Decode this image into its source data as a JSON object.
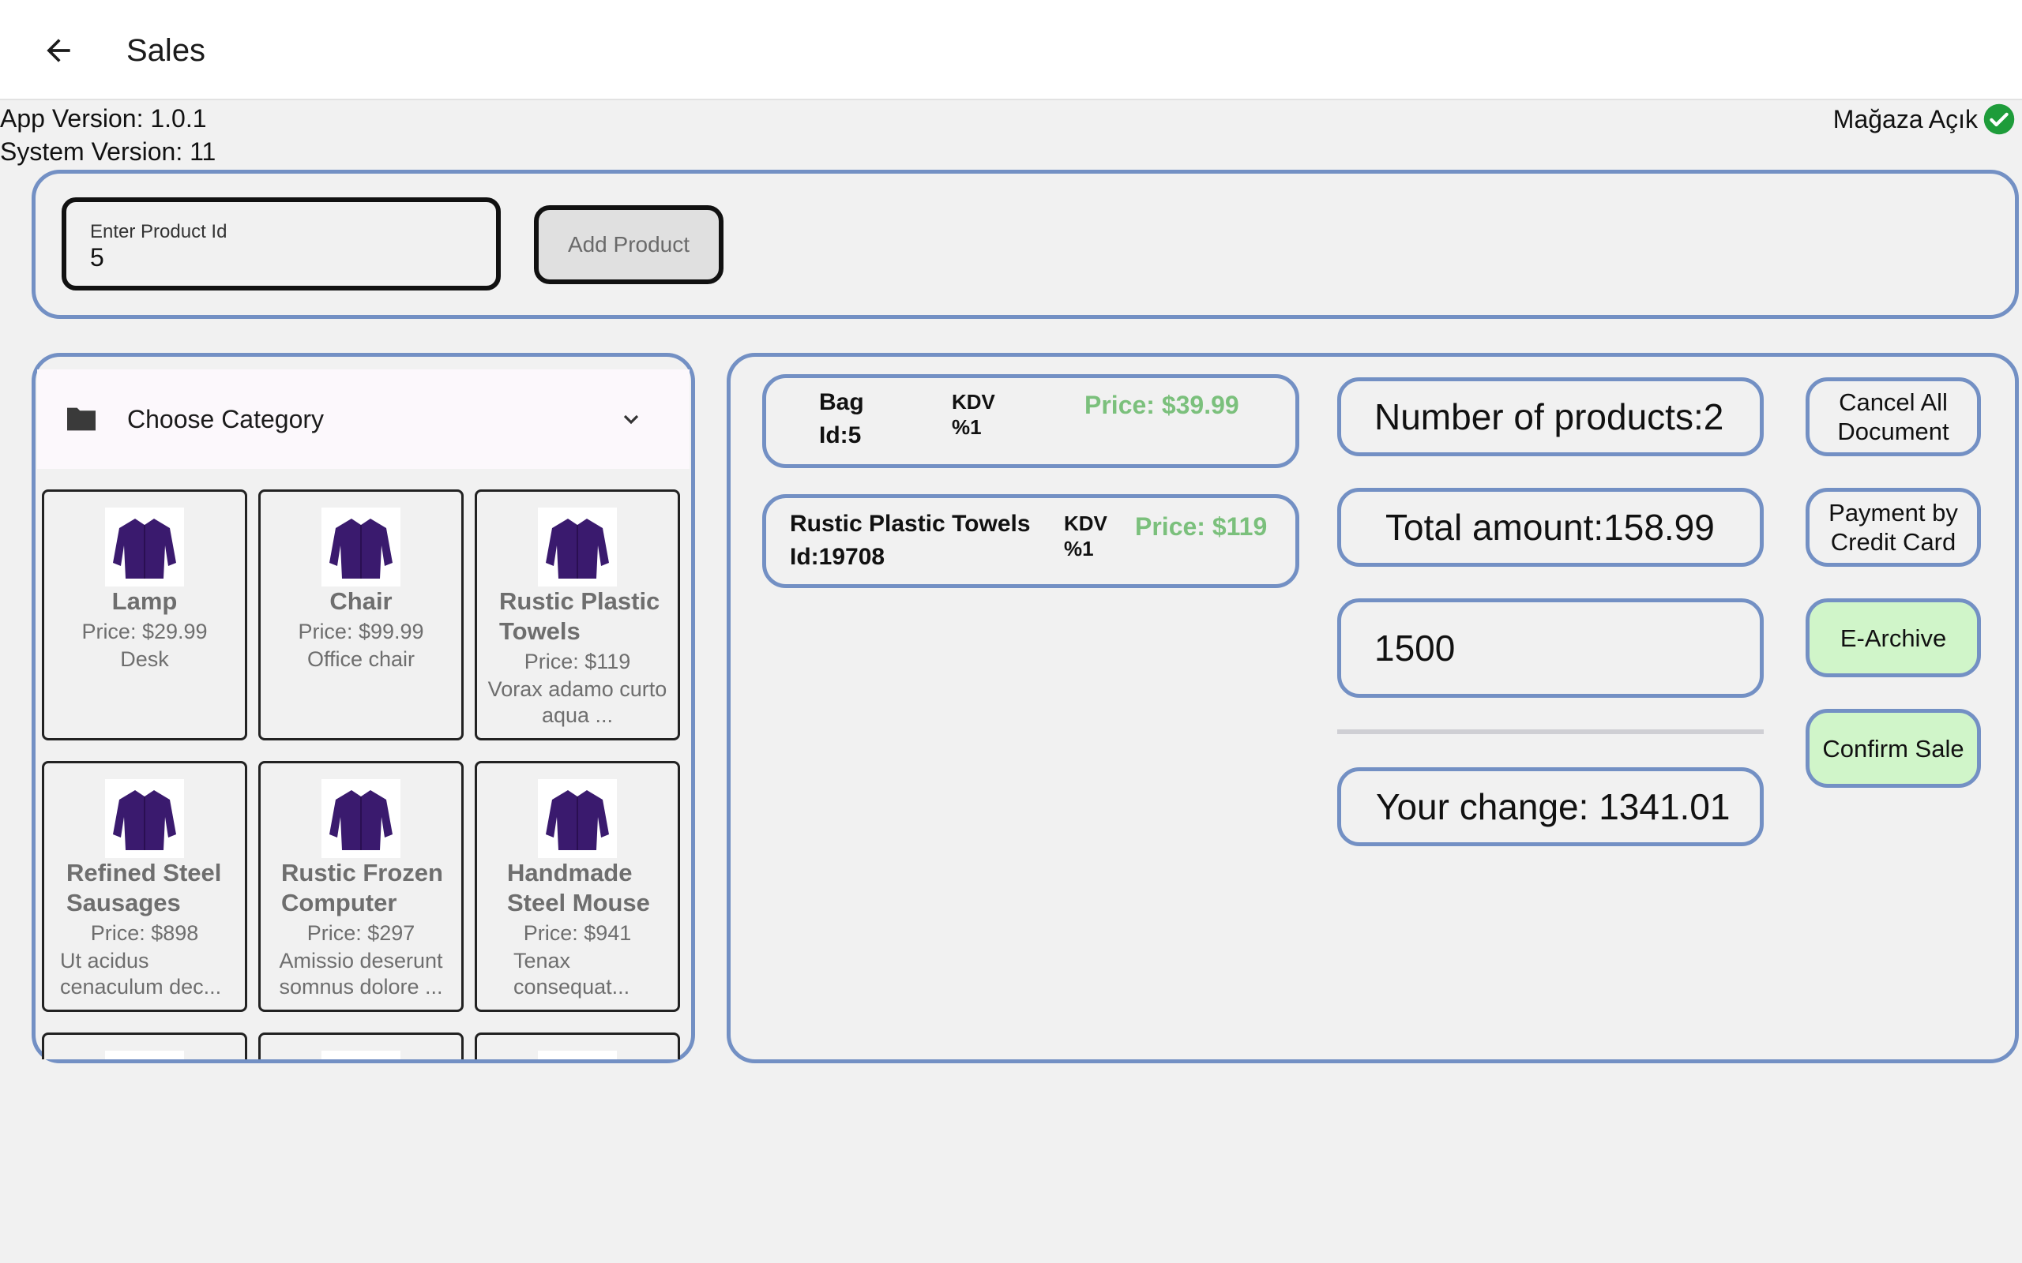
{
  "header": {
    "title": "Sales",
    "back_icon": "arrow-left-icon"
  },
  "info": {
    "app_version": "App Version: 1.0.1",
    "system_version": "System Version: 11",
    "store_status": "Mağaza Açık",
    "store_status_icon": "check-circle-icon",
    "store_status_color": "#1e9c3a"
  },
  "entry": {
    "field_label": "Enter Product Id",
    "field_value": "5",
    "add_button": "Add Product"
  },
  "category": {
    "label": "Choose Category",
    "folder_icon": "folder-icon",
    "chevron_icon": "chevron-down-icon"
  },
  "products": [
    {
      "name": "Lamp",
      "price": "Price: $29.99",
      "desc": "Desk"
    },
    {
      "name": "Chair",
      "price": "Price: $99.99",
      "desc": "Office chair"
    },
    {
      "name": "Rustic Plastic Towels",
      "price": "Price: $119",
      "desc": "Vorax adamo curto aqua ..."
    },
    {
      "name": "Refined Steel Sausages",
      "price": "Price: $898",
      "desc": "Ut acidus cenaculum dec..."
    },
    {
      "name": "Rustic Frozen Computer",
      "price": "Price: $297",
      "desc": "Amissio deserunt somnus dolore ..."
    },
    {
      "name": "Handmade Steel Mouse",
      "price": "Price: $941",
      "desc": "Tenax consequat..."
    }
  ],
  "cart": [
    {
      "name": "Bag",
      "id": "Id:5",
      "kdv": "KDV",
      "kdv_rate": "%1",
      "price": "Price: $39.99"
    },
    {
      "name": "Rustic Plastic Towels",
      "id": "Id:19708",
      "kdv": "KDV",
      "kdv_rate": "%1",
      "price": "Price: $119"
    }
  ],
  "summary": {
    "product_count": "Number of products:2",
    "total": "Total amount:158.99",
    "paid_value": "1500",
    "change": "Your change: 1341.01"
  },
  "actions": {
    "cancel": "Cancel All Document",
    "credit_card": "Payment by Credit Card",
    "e_archive": "E-Archive",
    "confirm": "Confirm Sale"
  },
  "colors": {
    "accent_border": "#7390c4",
    "price_green": "#7bc07c",
    "button_green": "#d0f5c9",
    "product_purple": "#3a1a6e"
  }
}
